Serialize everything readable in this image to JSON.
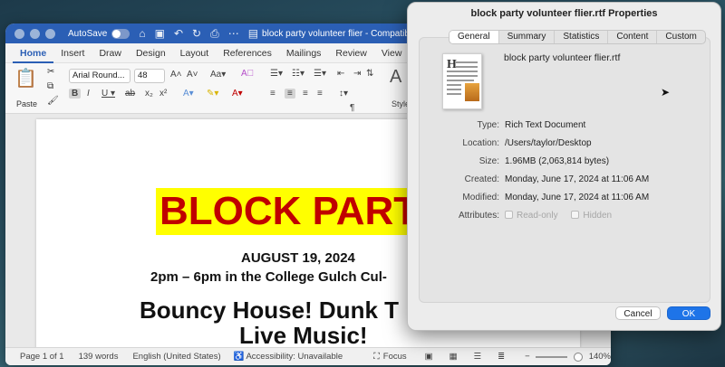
{
  "word": {
    "autosave_label": "AutoSave",
    "doc_title": "block party volunteer flier  -  Compatibility Mo",
    "tabs": [
      "Home",
      "Insert",
      "Draw",
      "Design",
      "Layout",
      "References",
      "Mailings",
      "Review",
      "View"
    ],
    "font_name": "Arial Round...",
    "font_size": "48",
    "paste_label": "Paste",
    "styles_label": "Style",
    "document": {
      "banner": "BLOCK PART",
      "date": "AUGUST 19, 2024",
      "time": "2pm – 6pm in the College Gulch Cul-",
      "line3": "Bouncy House!     Dunk T",
      "line4": "Live Music!"
    },
    "status": {
      "page": "Page 1 of 1",
      "words": "139 words",
      "language": "English (United States)",
      "accessibility": "Accessibility: Unavailable",
      "focus": "Focus",
      "zoom": "140%"
    }
  },
  "dialog": {
    "title": "block party volunteer flier.rtf Properties",
    "tabs": [
      "General",
      "Summary",
      "Statistics",
      "Content",
      "Custom"
    ],
    "active_tab": "General",
    "filename": "block party volunteer flier.rtf",
    "type_label": "Type:",
    "type_value": "Rich Text Document",
    "location_label": "Location:",
    "location_value": "/Users/taylor/Desktop",
    "size_label": "Size:",
    "size_value": "1.96MB (2,063,814 bytes)",
    "created_label": "Created:",
    "created_value": "Monday, June 17, 2024 at 11:06 AM",
    "modified_label": "Modified:",
    "modified_value": "Monday, June 17, 2024 at 11:06 AM",
    "attributes_label": "Attributes:",
    "readonly_label": "Read-only",
    "hidden_label": "Hidden",
    "cancel_label": "Cancel",
    "ok_label": "OK"
  },
  "colors": {
    "word_blue": "#2b5fb5",
    "banner_yellow": "#ffff00",
    "banner_red": "#c00000",
    "ok_blue": "#1e74e8"
  }
}
